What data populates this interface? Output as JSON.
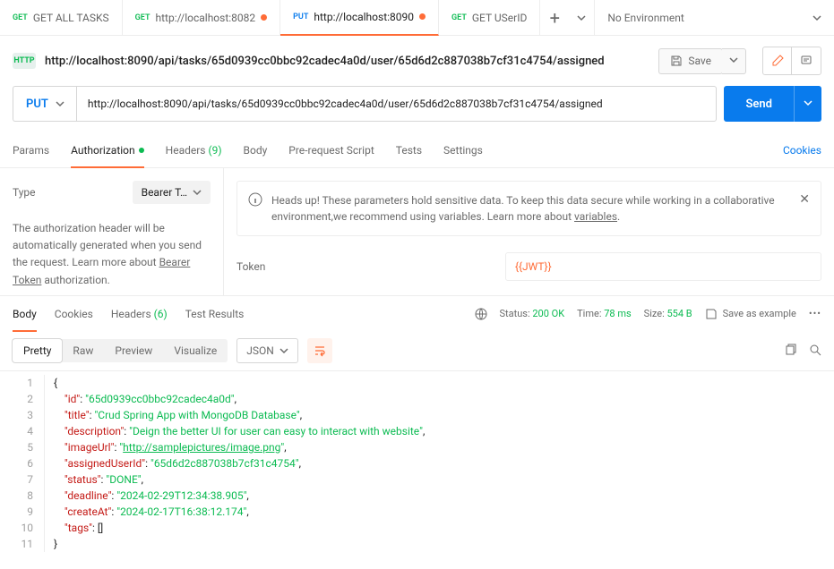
{
  "tabs": [
    {
      "method": "GET",
      "methodClass": "method-get",
      "title": "GET ALL TASKS",
      "dot": false
    },
    {
      "method": "GET",
      "methodClass": "method-get",
      "title": "http://localhost:8082",
      "dot": true
    },
    {
      "method": "PUT",
      "methodClass": "method-put",
      "title": "http://localhost:8090",
      "dot": true
    },
    {
      "method": "GET",
      "methodClass": "method-get",
      "title": "GET USerID",
      "dot": false
    }
  ],
  "env": "No Environment",
  "titleUrl": "http://localhost:8090/api/tasks/65d0939cc0bbc92cadec4a0d/user/65d6d2c887038b7cf31c4754/assigned",
  "save": "Save",
  "method": "PUT",
  "url": "http://localhost:8090/api/tasks/65d0939cc0bbc92cadec4a0d/user/65d6d2c887038b7cf31c4754/assigned",
  "send": "Send",
  "reqTabs": {
    "params": "Params",
    "auth": "Authorization",
    "headers": "Headers",
    "headersCount": "(9)",
    "body": "Body",
    "pre": "Pre-request Script",
    "tests": "Tests",
    "settings": "Settings",
    "cookies": "Cookies"
  },
  "auth": {
    "typeLabel": "Type",
    "typeValue": "Bearer T…",
    "desc1": "The authorization header will be automatically generated when you send the request. Learn more about ",
    "descLink": "Bearer Token",
    "desc2": " authorization.",
    "banner1": "Heads up! These parameters hold sensitive data. To keep this data secure while working in a collaborative environment,we recommend using variables. Learn more about ",
    "bannerLink": "variables",
    "tokenLabel": "Token",
    "tokenValue": "{{JWT}}"
  },
  "resp": {
    "body": "Body",
    "cookies": "Cookies",
    "headers": "Headers",
    "headersCount": "(6)",
    "test": "Test Results",
    "statusLabel": "Status:",
    "status": "200 OK",
    "timeLabel": "Time:",
    "time": "78 ms",
    "sizeLabel": "Size:",
    "size": "554 B",
    "saveExample": "Save as example"
  },
  "view": {
    "pretty": "Pretty",
    "raw": "Raw",
    "preview": "Preview",
    "visualize": "Visualize",
    "format": "JSON"
  },
  "json": {
    "id": "65d0939cc0bbc92cadec4a0d",
    "title": "Crud Spring App with MongoDB Database",
    "description": "Deign the better UI for user can easy to interact with website",
    "imageUrl": "http://samplepictures/image.png",
    "assignedUserId": "65d6d2c887038b7cf31c4754",
    "status": "DONE",
    "deadline": "2024-02-29T12:34:38.905",
    "createAt": "2024-02-17T16:38:12.174"
  }
}
